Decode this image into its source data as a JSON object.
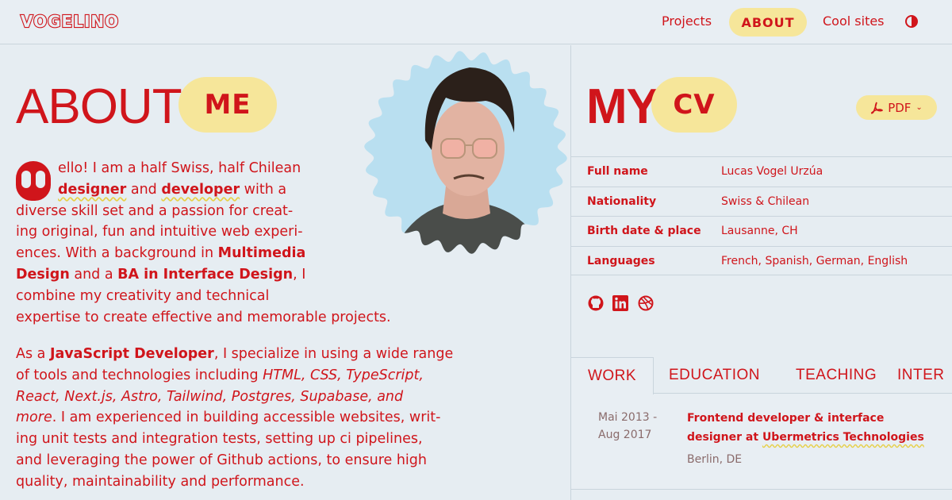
{
  "header": {
    "logo": "VOGELINO",
    "nav": [
      {
        "label": "Projects"
      },
      {
        "label": "ABOUT",
        "active": true
      },
      {
        "label": "Cool sites"
      }
    ],
    "theme_icon": "half-circle-icon"
  },
  "about": {
    "title": "ABOUT",
    "title_pill": "ME",
    "p1_lines": [
      "ello! I am a half Swiss, half Chilean",
      "designer and developer with a",
      "diverse skill set and a passion for creat-",
      "ing original, fun and intuitive web experi-",
      "ences. With a background in Multimedia",
      "Design and a BA in Interface Design, I",
      "combine my creativity and technical",
      "expertise to create effective and memorable projects."
    ],
    "p2_lines": [
      "As a JavaScript Developer, I specialize in using a wide range",
      "of tools and technologies including HTML, CSS, TypeScript,",
      "React, Next.js, Astro, Tailwind, Postgres, Supabase, and",
      "more. I am experienced in building accessible websites, writ-",
      "ing unit tests and integration tests, setting up ci pipelines,",
      "and leveraging the power of Github actions, to ensure high",
      "quality, maintainability and performance."
    ],
    "drop_cap": "H"
  },
  "cv": {
    "title": "MY",
    "title_pill": "CV",
    "pdf_label": "PDF",
    "info": [
      {
        "key": "Full name",
        "value": "Lucas Vogel Urzúa"
      },
      {
        "key": "Nationality",
        "value": "Swiss & Chilean"
      },
      {
        "key": "Birth date & place",
        "value": "Lausanne, CH"
      },
      {
        "key": "Languages",
        "value": "French, Spanish, German, English"
      }
    ],
    "social": [
      "github-icon",
      "linkedin-icon",
      "dribbble-icon"
    ],
    "tabs": [
      "WORK",
      "EDUCATION",
      "TEACHING",
      "INTER"
    ],
    "job": {
      "date_from": "Mai 2013 -",
      "date_to": "Aug 2017",
      "title_line1": "Frontend developer & interface",
      "title_line2_pre": "designer at ",
      "title_line2_company": "Ubermetrics Technologies",
      "location": "Berlin, DE"
    }
  },
  "colors": {
    "accent": "#d0151b",
    "highlight": "#f6e69a",
    "background": "#e6edf2"
  }
}
